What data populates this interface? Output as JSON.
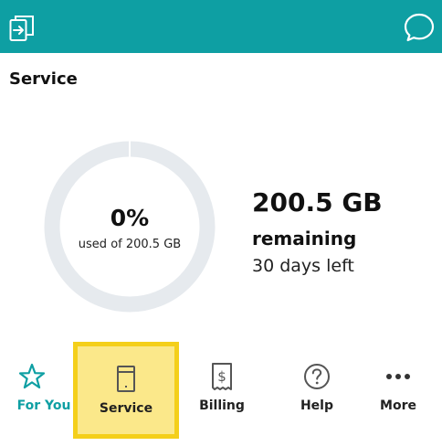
{
  "colors": {
    "brand_teal": "#0e9fa3",
    "ring_track": "#e6eaee",
    "highlight_yellow": "#f4cf1a",
    "highlight_fill": "#fbe88a"
  },
  "header": {
    "left_icon": "account-switch-icon",
    "right_icon": "chat-bubble-icon"
  },
  "page": {
    "title": "Service"
  },
  "usage": {
    "percent_used": 0,
    "percent_text": "0%",
    "caption": "used of 200.5 GB",
    "remaining_amount": "200.5 GB",
    "remaining_label": "remaining",
    "days_left": "30 days left"
  },
  "bottom_nav": {
    "items": [
      {
        "label": "For You",
        "icon": "star-icon",
        "state": "active"
      },
      {
        "label": "Service",
        "icon": "device-icon",
        "state": "highlighted"
      },
      {
        "label": "Billing",
        "icon": "bill-icon",
        "state": "normal"
      },
      {
        "label": "Help",
        "icon": "help-icon",
        "state": "normal"
      },
      {
        "label": "More",
        "icon": "more-dots-icon",
        "state": "normal"
      }
    ]
  }
}
